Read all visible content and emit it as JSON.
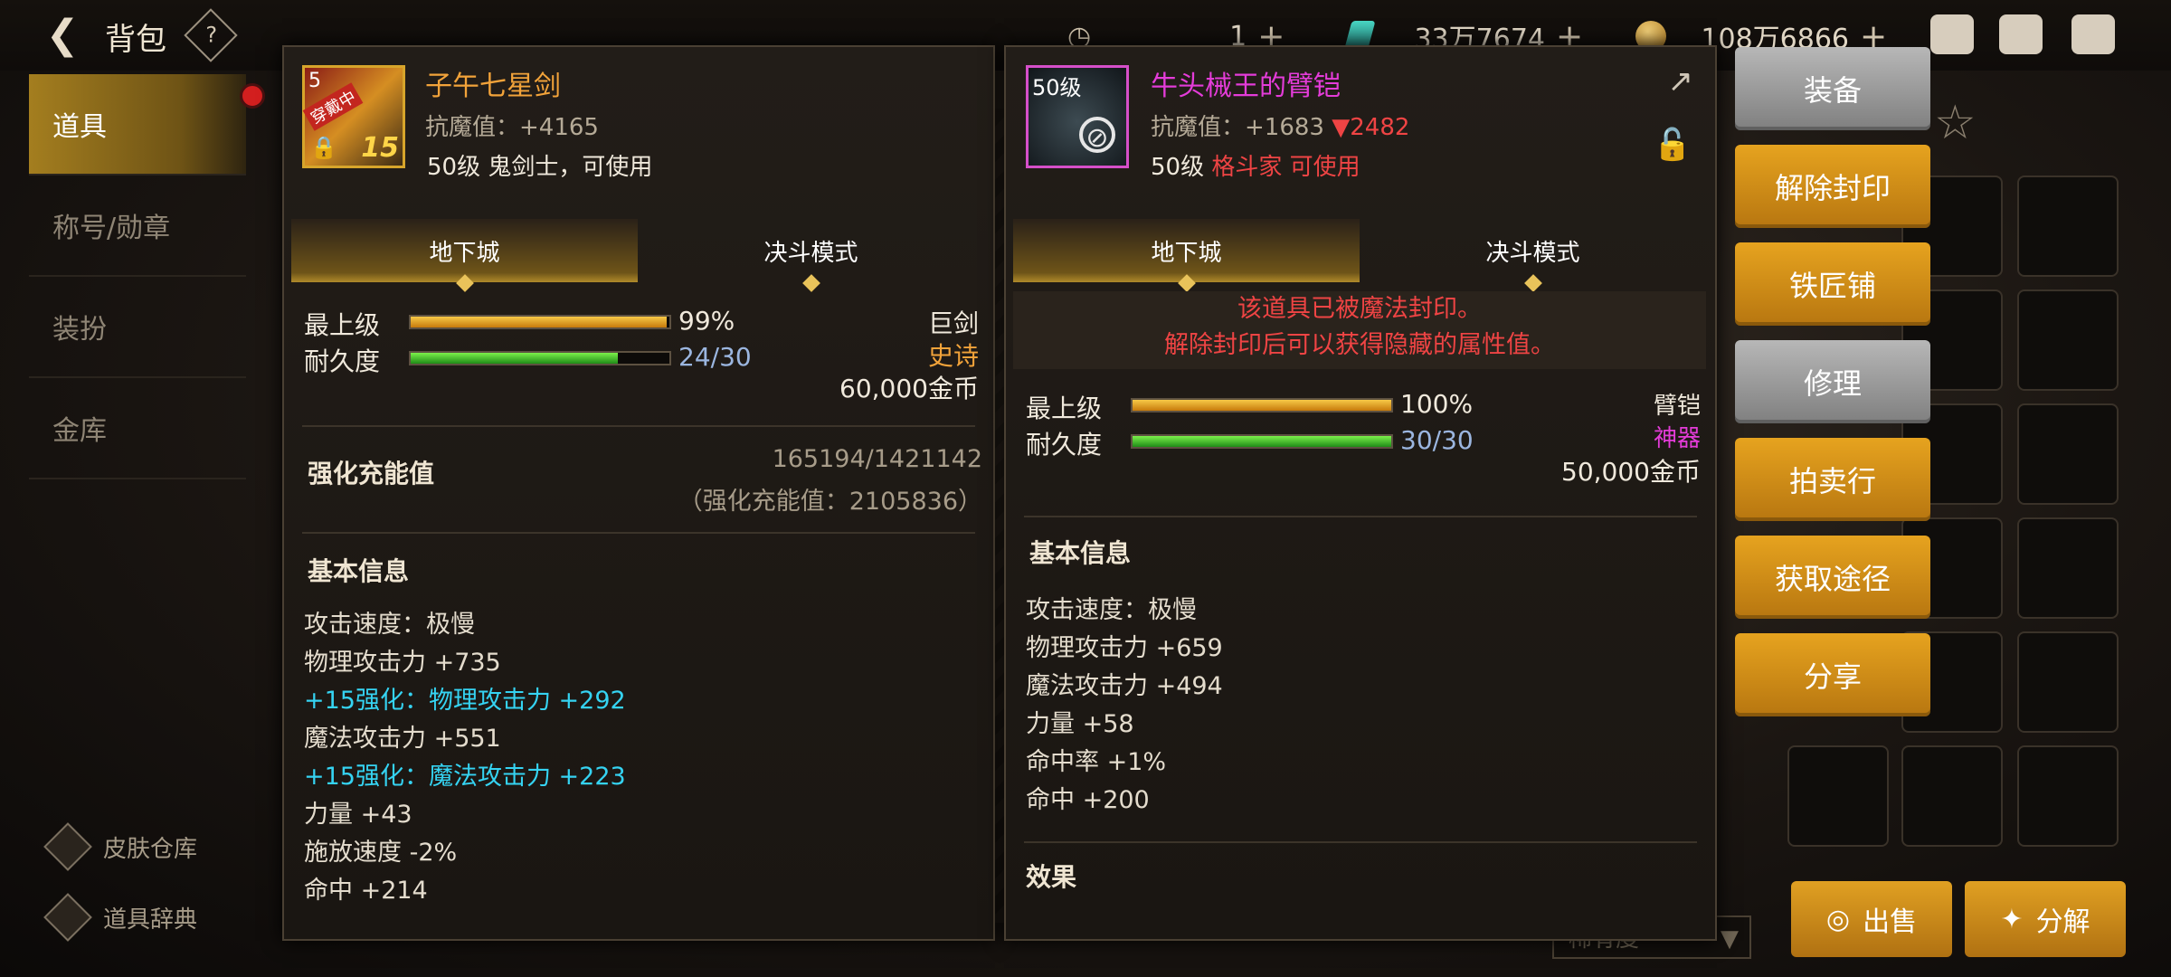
{
  "header": {
    "title": "背包",
    "help_icon": "?",
    "currencies": [
      {
        "value": "1",
        "icon": "clock-icon"
      },
      {
        "value": "33万7674",
        "icon": "gem-icon"
      },
      {
        "value": "108万6866",
        "icon": "coin-icon"
      }
    ]
  },
  "sidebar": {
    "items": [
      {
        "label": "道具",
        "active": true
      },
      {
        "label": "称号/勋章"
      },
      {
        "label": "装扮"
      },
      {
        "label": "金库"
      }
    ],
    "links": [
      {
        "label": "皮肤仓库"
      },
      {
        "label": "道具辞典"
      }
    ]
  },
  "item_left": {
    "badge_level": "5",
    "badge_equipped": "穿戴中",
    "enhance_level": "15",
    "name": "子午七星剑",
    "anti_magic": "抗魔值：+4165",
    "requirement": "50级 鬼剑士，可使用",
    "tabs": [
      "地下城",
      "决斗模式"
    ],
    "max_level_label": "最上级",
    "max_level_value": "99%",
    "max_level_fraction": 0.99,
    "durability_label": "耐久度",
    "durability_value": "24/30",
    "durability_fraction": 0.8,
    "type": "巨剑",
    "rarity": "史诗",
    "price": "60,000金币",
    "charge_label": "强化充能值",
    "charge_value": "165194/1421142",
    "charge_total": "（强化充能值：2105836）",
    "basic_info_title": "基本信息",
    "stats": [
      {
        "text": "攻击速度：极慢",
        "color": "normal"
      },
      {
        "text": "物理攻击力 +735",
        "color": "normal"
      },
      {
        "text": "+15强化：物理攻击力 +292",
        "color": "cyan"
      },
      {
        "text": "魔法攻击力 +551",
        "color": "normal"
      },
      {
        "text": "+15强化：魔法攻击力 +223",
        "color": "cyan"
      },
      {
        "text": "力量 +43",
        "color": "normal"
      },
      {
        "text": "施放速度 -2%",
        "color": "normal"
      },
      {
        "text": "命中 +214",
        "color": "normal"
      }
    ]
  },
  "item_right": {
    "badge_level": "50级",
    "name": "牛头械王的臂铠",
    "anti_magic": "抗魔值：+1683",
    "anti_magic_diff": "▼2482",
    "req_level": "50级",
    "req_class": "格斗家 可使用",
    "tabs": [
      "地下城",
      "决斗模式"
    ],
    "sealed_line1": "该道具已被魔法封印。",
    "sealed_line2": "解除封印后可以获得隐藏的属性值。",
    "max_level_label": "最上级",
    "max_level_value": "100%",
    "max_level_fraction": 1.0,
    "durability_label": "耐久度",
    "durability_value": "30/30",
    "durability_fraction": 1.0,
    "type": "臂铠",
    "rarity": "神器",
    "price": "50,000金币",
    "basic_info_title": "基本信息",
    "stats": [
      "攻击速度：极慢",
      "物理攻击力 +659",
      "魔法攻击力 +494",
      "力量 +58",
      "命中率 +1%",
      "命中 +200"
    ],
    "effect_title": "效果"
  },
  "actions": [
    {
      "label": "装备",
      "style": "gray"
    },
    {
      "label": "解除封印",
      "style": "gold"
    },
    {
      "label": "铁匠铺",
      "style": "gold"
    },
    {
      "label": "修理",
      "style": "gray"
    },
    {
      "label": "拍卖行",
      "style": "gold"
    },
    {
      "label": "获取途径",
      "style": "gold"
    },
    {
      "label": "分享",
      "style": "gold"
    }
  ],
  "bottom": {
    "sell_label": "出售",
    "decompose_label": "分解",
    "sort_label": "稀有度"
  },
  "colors": {
    "gold": "#e6a31f",
    "epic": "#f2a33a",
    "legendary": "#e43cd9",
    "cyan": "#35d3f2",
    "red": "#ef4444"
  }
}
